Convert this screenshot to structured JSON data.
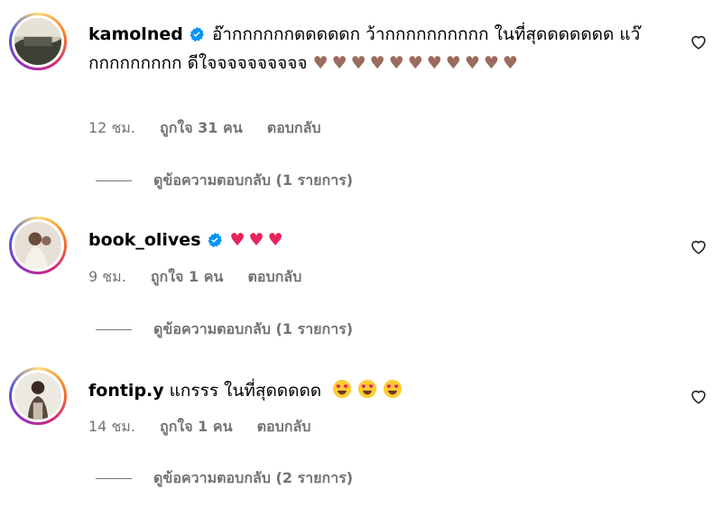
{
  "comments": [
    {
      "username": "kamolned",
      "text": "อ๊ากกกกกกดดดดดก ว้ากกกกกกกกกก ในที่สุดดดดดดด แว๊กกกกกกกกก ดีใจจจจจจจจจจ",
      "hearts": "♥♥♥♥♥♥♥♥♥♥♥",
      "time": "12 ชม.",
      "likes": "ถูกใจ 31 คน",
      "reply": "ตอบกลับ",
      "view_replies": "ดูข้อความตอบกลับ (1 รายการ)"
    },
    {
      "username": "book_olives",
      "hearts": "♥♥♥",
      "time": "9 ชม.",
      "likes": "ถูกใจ 1 คน",
      "reply": "ตอบกลับ",
      "view_replies": "ดูข้อความตอบกลับ (1 รายการ)"
    },
    {
      "username": "fontip.y",
      "text": "แกรรร ในที่สุดดดดด",
      "time": "14 ชม.",
      "likes": "ถูกใจ 1 คน",
      "reply": "ตอบกลับ",
      "view_replies": "ดูข้อความตอบกลับ (2 รายการ)"
    }
  ],
  "colors": {
    "meta_text": "#737373",
    "verified": "#0095f6",
    "heart_brown": "#9b6b5d",
    "heart_pink": "#e8245a"
  },
  "icons": [
    "verified-badge-icon",
    "heart-outline-icon",
    "heart-eyes-emoji"
  ]
}
